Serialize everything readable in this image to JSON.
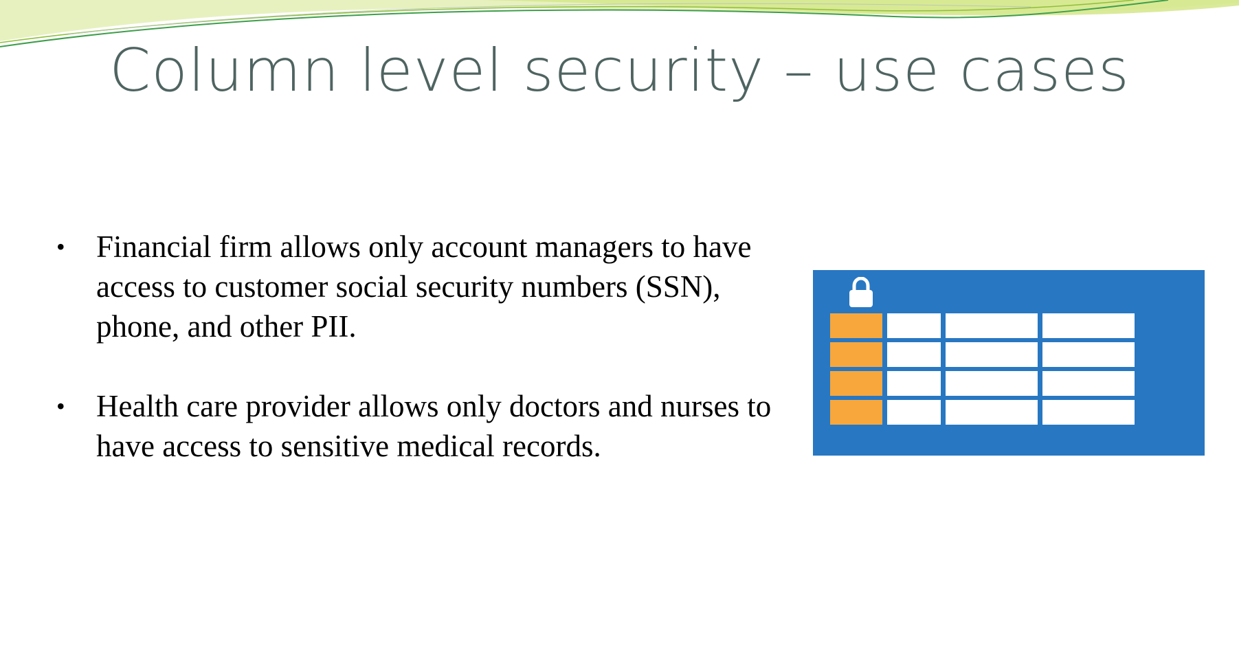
{
  "slide": {
    "title": "Column level security – use cases",
    "bullets": [
      {
        "marker": "•",
        "text": "Financial firm allows only account managers to have access to customer social security numbers (SSN), phone, and other PII."
      },
      {
        "marker": "•",
        "text": "Health care provider allows only doctors and nurses to have access to sensitive medical records."
      }
    ]
  },
  "graphic": {
    "icon": "lock-icon",
    "background_color": "#2877c2",
    "key_column_color": "#f7a73c",
    "cell_color": "#ffffff",
    "rows": 4,
    "columns": 4
  },
  "theme": {
    "title_color": "#4f6461",
    "swoosh_colors": [
      "#c9df7a",
      "#8fbf3a",
      "#3e9e4a"
    ]
  }
}
